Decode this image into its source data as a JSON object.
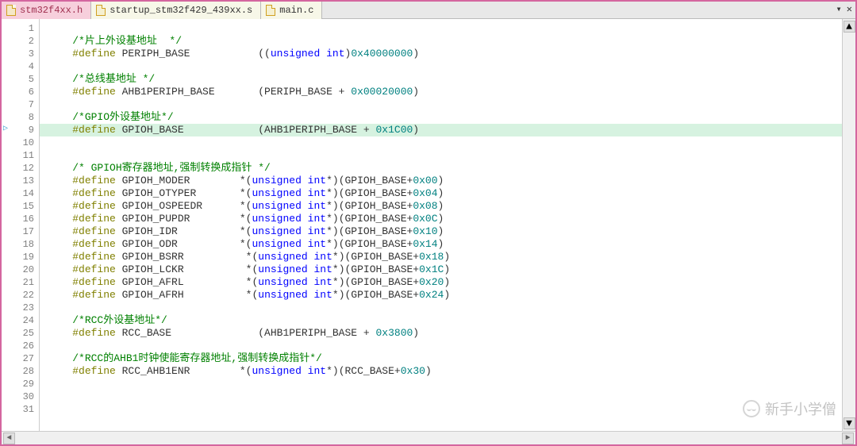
{
  "tabs": [
    {
      "name": "stm32f4xx.h",
      "active": true,
      "iconClass": "h"
    },
    {
      "name": "startup_stm32f429_439xx.s",
      "active": false,
      "iconClass": "s"
    },
    {
      "name": "main.c",
      "active": false,
      "iconClass": "c"
    }
  ],
  "controls": {
    "dropdown": "▾",
    "close": "✕"
  },
  "highlightLine": 9,
  "markerLine": 9,
  "markerGlyph": "▷",
  "lines": [
    {
      "n": 1,
      "tokens": []
    },
    {
      "n": 2,
      "tokens": [
        {
          "t": "    ",
          "c": ""
        },
        {
          "t": "/*片上外设基地址  */",
          "c": "tok-comment"
        }
      ]
    },
    {
      "n": 3,
      "tokens": [
        {
          "t": "    ",
          "c": ""
        },
        {
          "t": "#define",
          "c": "tok-pp"
        },
        {
          "t": " PERIPH_BASE           ((",
          "c": "tok-ident"
        },
        {
          "t": "unsigned int",
          "c": "tok-kw"
        },
        {
          "t": ")",
          "c": "tok-ident"
        },
        {
          "t": "0x40000000",
          "c": "tok-num"
        },
        {
          "t": ")",
          "c": "tok-ident"
        }
      ]
    },
    {
      "n": 4,
      "tokens": []
    },
    {
      "n": 5,
      "tokens": [
        {
          "t": "    ",
          "c": ""
        },
        {
          "t": "/*总线基地址 */",
          "c": "tok-comment"
        }
      ]
    },
    {
      "n": 6,
      "tokens": [
        {
          "t": "    ",
          "c": ""
        },
        {
          "t": "#define",
          "c": "tok-pp"
        },
        {
          "t": " AHB1PERIPH_BASE       (PERIPH_BASE + ",
          "c": "tok-ident"
        },
        {
          "t": "0x00020000",
          "c": "tok-num"
        },
        {
          "t": ")",
          "c": "tok-ident"
        }
      ]
    },
    {
      "n": 7,
      "tokens": []
    },
    {
      "n": 8,
      "tokens": [
        {
          "t": "    ",
          "c": ""
        },
        {
          "t": "/*GPIO外设基地址*/",
          "c": "tok-comment"
        }
      ]
    },
    {
      "n": 9,
      "tokens": [
        {
          "t": "    ",
          "c": ""
        },
        {
          "t": "#define",
          "c": "tok-pp"
        },
        {
          "t": " GPIOH_BASE            (AHB1PERIPH_BASE + ",
          "c": "tok-ident"
        },
        {
          "t": "0x1C00",
          "c": "tok-num"
        },
        {
          "t": ")",
          "c": "tok-ident"
        }
      ]
    },
    {
      "n": 10,
      "tokens": []
    },
    {
      "n": 11,
      "tokens": []
    },
    {
      "n": 12,
      "tokens": [
        {
          "t": "    ",
          "c": ""
        },
        {
          "t": "/* GPIOH寄存器地址,强制转换成指针 */",
          "c": "tok-comment"
        }
      ]
    },
    {
      "n": 13,
      "tokens": [
        {
          "t": "    ",
          "c": ""
        },
        {
          "t": "#define",
          "c": "tok-pp"
        },
        {
          "t": " GPIOH_MODER        *(",
          "c": "tok-ident"
        },
        {
          "t": "unsigned int",
          "c": "tok-kw"
        },
        {
          "t": "*)(GPIOH_BASE+",
          "c": "tok-ident"
        },
        {
          "t": "0x00",
          "c": "tok-num"
        },
        {
          "t": ")",
          "c": "tok-ident"
        }
      ]
    },
    {
      "n": 14,
      "tokens": [
        {
          "t": "    ",
          "c": ""
        },
        {
          "t": "#define",
          "c": "tok-pp"
        },
        {
          "t": " GPIOH_OTYPER       *(",
          "c": "tok-ident"
        },
        {
          "t": "unsigned int",
          "c": "tok-kw"
        },
        {
          "t": "*)(GPIOH_BASE+",
          "c": "tok-ident"
        },
        {
          "t": "0x04",
          "c": "tok-num"
        },
        {
          "t": ")",
          "c": "tok-ident"
        }
      ]
    },
    {
      "n": 15,
      "tokens": [
        {
          "t": "    ",
          "c": ""
        },
        {
          "t": "#define",
          "c": "tok-pp"
        },
        {
          "t": " GPIOH_OSPEEDR      *(",
          "c": "tok-ident"
        },
        {
          "t": "unsigned int",
          "c": "tok-kw"
        },
        {
          "t": "*)(GPIOH_BASE+",
          "c": "tok-ident"
        },
        {
          "t": "0x08",
          "c": "tok-num"
        },
        {
          "t": ")",
          "c": "tok-ident"
        }
      ]
    },
    {
      "n": 16,
      "tokens": [
        {
          "t": "    ",
          "c": ""
        },
        {
          "t": "#define",
          "c": "tok-pp"
        },
        {
          "t": " GPIOH_PUPDR        *(",
          "c": "tok-ident"
        },
        {
          "t": "unsigned int",
          "c": "tok-kw"
        },
        {
          "t": "*)(GPIOH_BASE+",
          "c": "tok-ident"
        },
        {
          "t": "0x0C",
          "c": "tok-num"
        },
        {
          "t": ")",
          "c": "tok-ident"
        }
      ]
    },
    {
      "n": 17,
      "tokens": [
        {
          "t": "    ",
          "c": ""
        },
        {
          "t": "#define",
          "c": "tok-pp"
        },
        {
          "t": " GPIOH_IDR          *(",
          "c": "tok-ident"
        },
        {
          "t": "unsigned int",
          "c": "tok-kw"
        },
        {
          "t": "*)(GPIOH_BASE+",
          "c": "tok-ident"
        },
        {
          "t": "0x10",
          "c": "tok-num"
        },
        {
          "t": ")",
          "c": "tok-ident"
        }
      ]
    },
    {
      "n": 18,
      "tokens": [
        {
          "t": "    ",
          "c": ""
        },
        {
          "t": "#define",
          "c": "tok-pp"
        },
        {
          "t": " GPIOH_ODR          *(",
          "c": "tok-ident"
        },
        {
          "t": "unsigned int",
          "c": "tok-kw"
        },
        {
          "t": "*)(GPIOH_BASE+",
          "c": "tok-ident"
        },
        {
          "t": "0x14",
          "c": "tok-num"
        },
        {
          "t": ")",
          "c": "tok-ident"
        }
      ]
    },
    {
      "n": 19,
      "tokens": [
        {
          "t": "    ",
          "c": ""
        },
        {
          "t": "#define",
          "c": "tok-pp"
        },
        {
          "t": " GPIOH_BSRR          *(",
          "c": "tok-ident"
        },
        {
          "t": "unsigned int",
          "c": "tok-kw"
        },
        {
          "t": "*)(GPIOH_BASE+",
          "c": "tok-ident"
        },
        {
          "t": "0x18",
          "c": "tok-num"
        },
        {
          "t": ")",
          "c": "tok-ident"
        }
      ]
    },
    {
      "n": 20,
      "tokens": [
        {
          "t": "    ",
          "c": ""
        },
        {
          "t": "#define",
          "c": "tok-pp"
        },
        {
          "t": " GPIOH_LCKR          *(",
          "c": "tok-ident"
        },
        {
          "t": "unsigned int",
          "c": "tok-kw"
        },
        {
          "t": "*)(GPIOH_BASE+",
          "c": "tok-ident"
        },
        {
          "t": "0x1C",
          "c": "tok-num"
        },
        {
          "t": ")",
          "c": "tok-ident"
        }
      ]
    },
    {
      "n": 21,
      "tokens": [
        {
          "t": "    ",
          "c": ""
        },
        {
          "t": "#define",
          "c": "tok-pp"
        },
        {
          "t": " GPIOH_AFRL          *(",
          "c": "tok-ident"
        },
        {
          "t": "unsigned int",
          "c": "tok-kw"
        },
        {
          "t": "*)(GPIOH_BASE+",
          "c": "tok-ident"
        },
        {
          "t": "0x20",
          "c": "tok-num"
        },
        {
          "t": ")",
          "c": "tok-ident"
        }
      ]
    },
    {
      "n": 22,
      "tokens": [
        {
          "t": "    ",
          "c": ""
        },
        {
          "t": "#define",
          "c": "tok-pp"
        },
        {
          "t": " GPIOH_AFRH          *(",
          "c": "tok-ident"
        },
        {
          "t": "unsigned int",
          "c": "tok-kw"
        },
        {
          "t": "*)(GPIOH_BASE+",
          "c": "tok-ident"
        },
        {
          "t": "0x24",
          "c": "tok-num"
        },
        {
          "t": ")",
          "c": "tok-ident"
        }
      ]
    },
    {
      "n": 23,
      "tokens": []
    },
    {
      "n": 24,
      "tokens": [
        {
          "t": "    ",
          "c": ""
        },
        {
          "t": "/*RCC外设基地址*/",
          "c": "tok-comment"
        }
      ]
    },
    {
      "n": 25,
      "tokens": [
        {
          "t": "    ",
          "c": ""
        },
        {
          "t": "#define",
          "c": "tok-pp"
        },
        {
          "t": " RCC_BASE              (AHB1PERIPH_BASE + ",
          "c": "tok-ident"
        },
        {
          "t": "0x3800",
          "c": "tok-num"
        },
        {
          "t": ")",
          "c": "tok-ident"
        }
      ]
    },
    {
      "n": 26,
      "tokens": []
    },
    {
      "n": 27,
      "tokens": [
        {
          "t": "    ",
          "c": ""
        },
        {
          "t": "/*RCC的AHB1时钟使能寄存器地址,强制转换成指针*/",
          "c": "tok-comment"
        }
      ]
    },
    {
      "n": 28,
      "tokens": [
        {
          "t": "    ",
          "c": ""
        },
        {
          "t": "#define",
          "c": "tok-pp"
        },
        {
          "t": " RCC_AHB1ENR        *(",
          "c": "tok-ident"
        },
        {
          "t": "unsigned int",
          "c": "tok-kw"
        },
        {
          "t": "*)(RCC_BASE+",
          "c": "tok-ident"
        },
        {
          "t": "0x30",
          "c": "tok-num"
        },
        {
          "t": ")",
          "c": "tok-ident"
        }
      ]
    },
    {
      "n": 29,
      "tokens": []
    },
    {
      "n": 30,
      "tokens": []
    },
    {
      "n": 31,
      "tokens": []
    }
  ],
  "watermark": {
    "text": "新手小学僧"
  },
  "scroll": {
    "left": "◄",
    "right": "►",
    "up": "▲",
    "down": "▼"
  }
}
